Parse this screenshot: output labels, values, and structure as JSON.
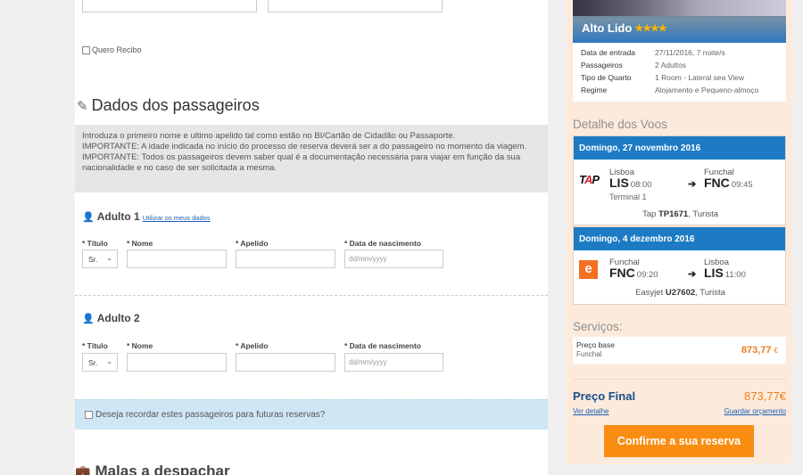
{
  "receipt": {
    "label": "Quero Recibo"
  },
  "passengers": {
    "title": "Dados dos passageiros",
    "info_lines": [
      "Introduza o primeiro nome e ultimo apelido tal como estão no BI/Cartão de Cidadão ou Passaporte.",
      "IMPORTANTE: A idade indicada no início do processo de reserva deverá ser a do passageiro no momento da viagem.",
      "IMPORTANTE: Todos os passageiros devem saber qual é a documentação necessária para viajar em função da sua nacionalidade e no caso de ser solicitada a mesma."
    ],
    "adults": [
      {
        "title": "Adulto 1",
        "use_my_data_link": "Utilizar os meus dados",
        "labels": {
          "title": "* Título",
          "name": "* Nome",
          "surname": "* Apelido",
          "birth": "* Data de nascimento"
        },
        "title_value": "Sr.",
        "birth_placeholder": "dd/mm/yyyy"
      },
      {
        "title": "Adulto 2",
        "labels": {
          "title": "* Título",
          "name": "* Nome",
          "surname": "* Apelido",
          "birth": "* Data de nascimento"
        },
        "title_value": "Sr.",
        "birth_placeholder": "dd/mm/yyyy"
      }
    ],
    "remember_label": "Deseja recordar estes passageiros para futuras reservas?"
  },
  "luggage": {
    "title": "Malas a despachar"
  },
  "hotel": {
    "name": "Alto Lido",
    "stars": "★★★★",
    "details": [
      {
        "key": "Data de entrada",
        "value": "27/11/2016, 7 noite/s"
      },
      {
        "key": "Passageiros",
        "value": "2 Adultos"
      },
      {
        "key": "Tipo de Quarto",
        "value": "1 Room - Lateral sea View"
      },
      {
        "key": "Regime",
        "value": "Alojamento e Pequeno-almoço"
      }
    ]
  },
  "flights": {
    "title": "Detalhe dos Voos",
    "outbound": {
      "date": "Domingo, 27 novembro 2016",
      "logo": "TAP",
      "from_city": "Lisboa",
      "from_code": "LIS",
      "from_time": "08:00",
      "terminal": "Terminal 1",
      "to_city": "Funchal",
      "to_code": "FNC",
      "to_time": "09:45",
      "carrier_prefix": "Tap",
      "flight_no": "TP1671",
      "class": ", Turista"
    },
    "inbound": {
      "date": "Domingo, 4 dezembro 2016",
      "logo": "e",
      "from_city": "Funchal",
      "from_code": "FNC",
      "from_time": "09:20",
      "to_city": "Lisboa",
      "to_code": "LIS",
      "to_time": "11:00",
      "carrier_prefix": "Easyjet",
      "flight_no": "U27602",
      "class": ", Turista"
    }
  },
  "services": {
    "title": "Serviços:",
    "base_label": "Preço base",
    "base_sub": "Funchal",
    "base_price": "873,77",
    "currency": "€"
  },
  "final": {
    "label": "Preço Final",
    "price": "873,77€",
    "details_link": "Ver detalhe",
    "save_link": "Guardar orçamento",
    "confirm_label": "Confirme a sua reserva"
  },
  "colors": {
    "accent_blue": "#1c7bc4",
    "accent_orange": "#f98d12",
    "price_orange": "#f07d1e"
  }
}
